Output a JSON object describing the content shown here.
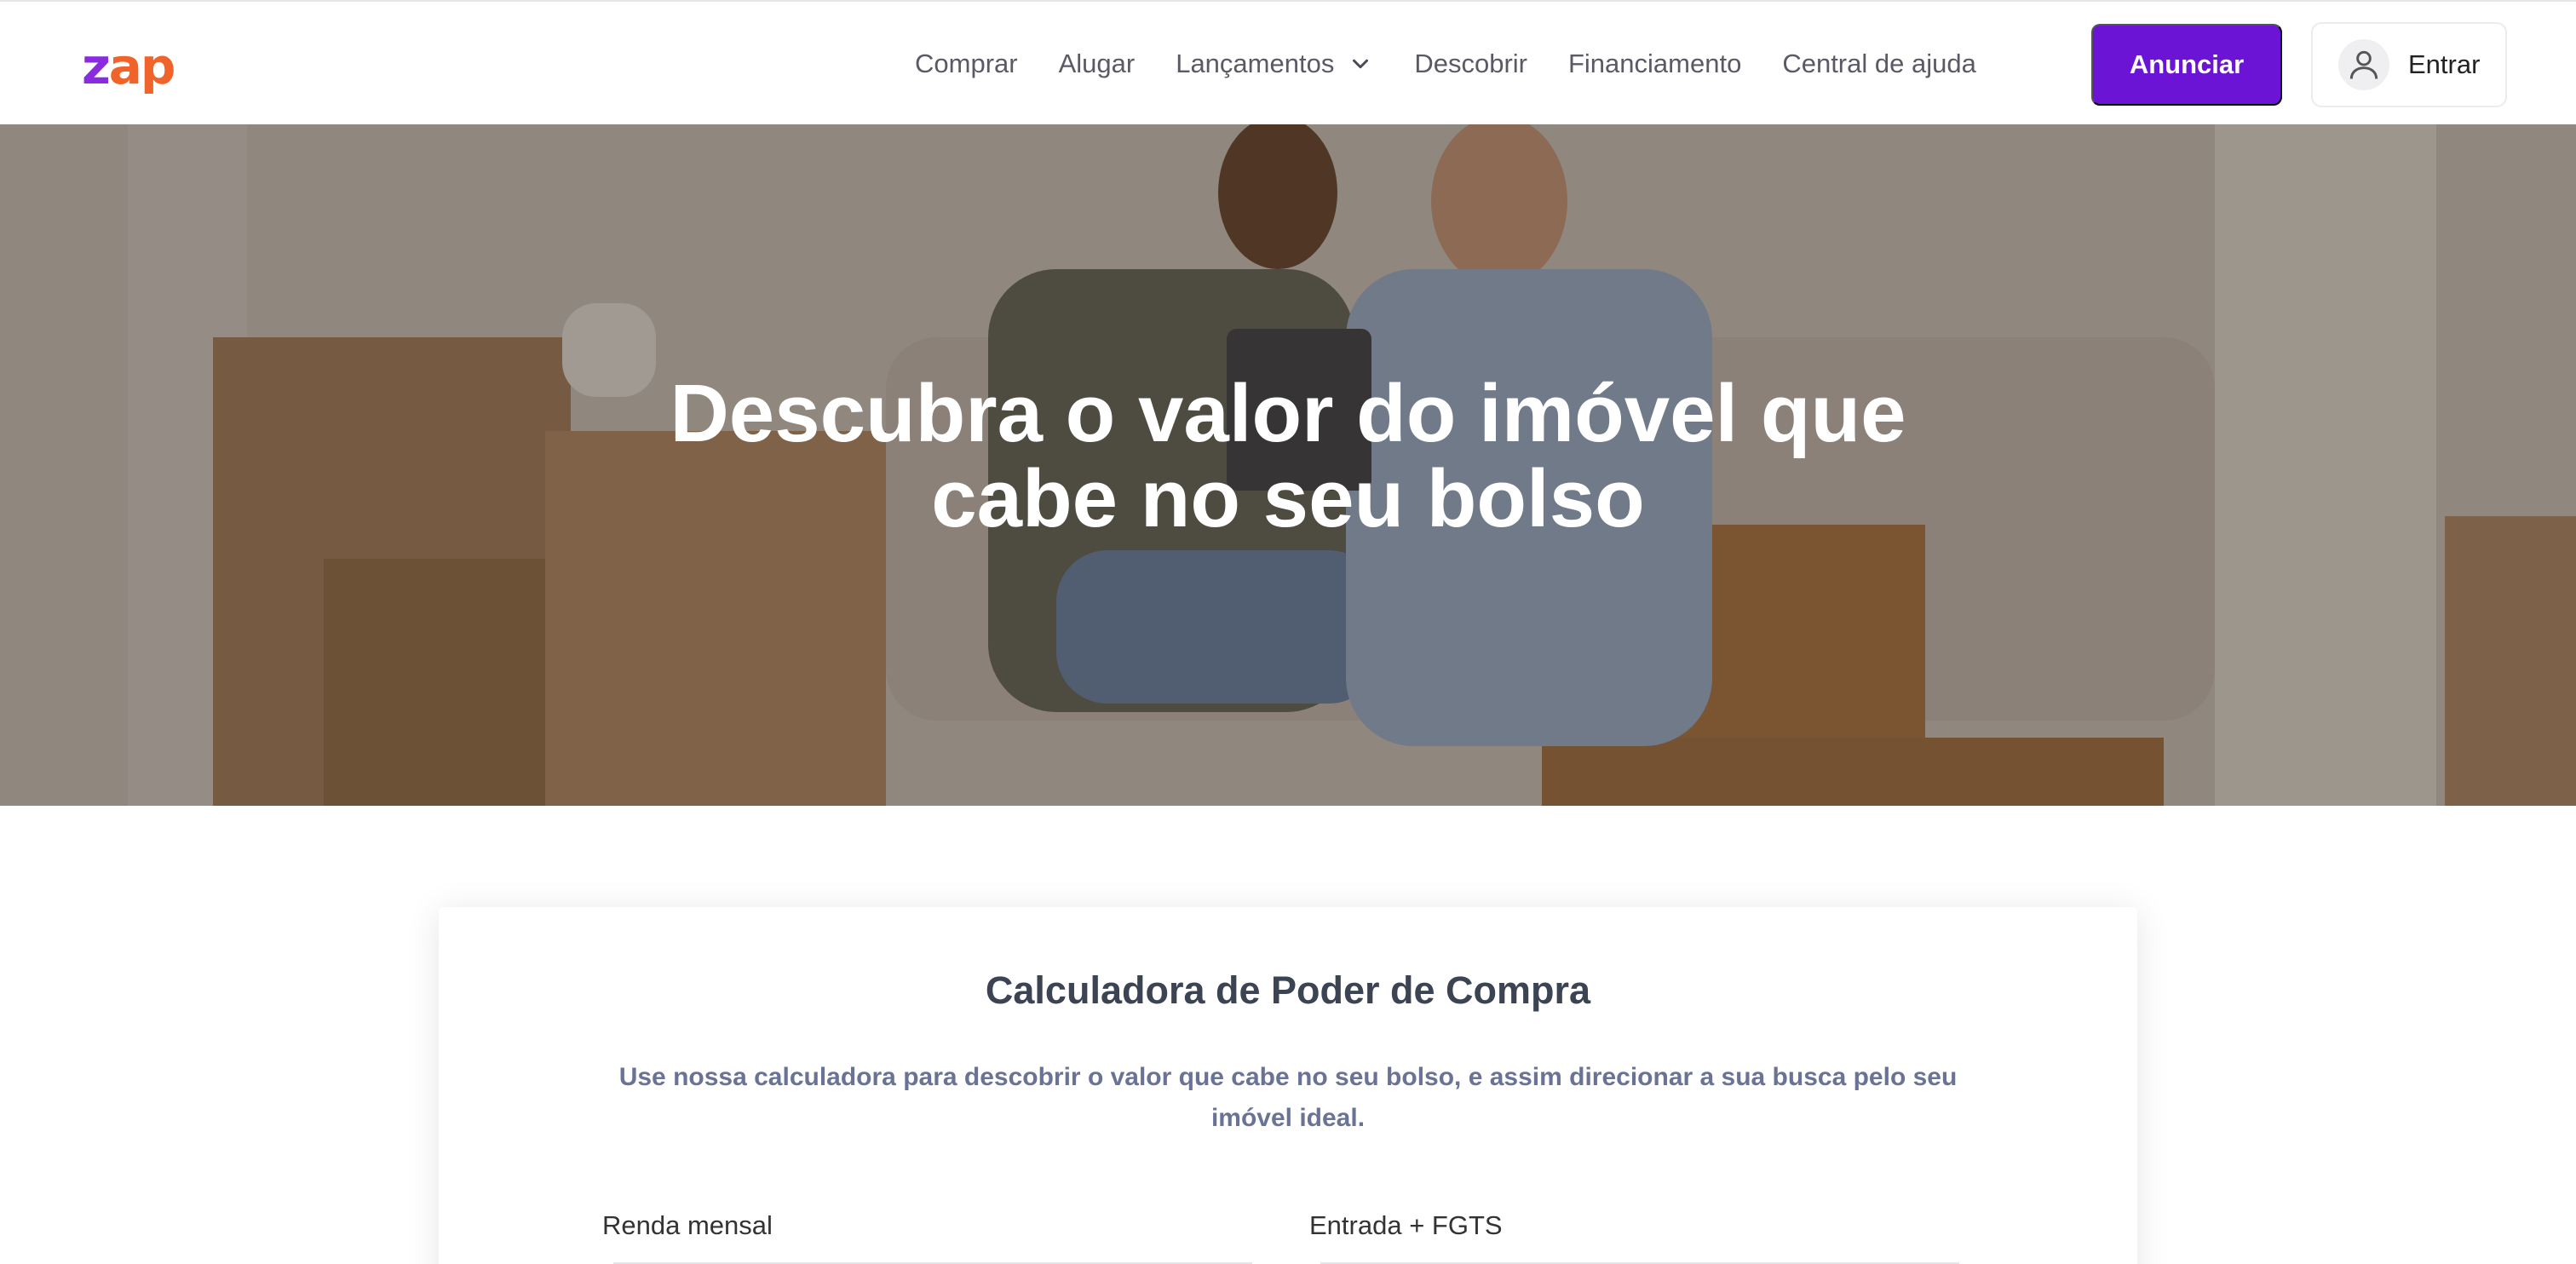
{
  "logo": {
    "z": "z",
    "rest": "ap"
  },
  "nav": {
    "comprar": "Comprar",
    "alugar": "Alugar",
    "lancamentos": "Lançamentos",
    "descobrir": "Descobrir",
    "financiamento": "Financiamento",
    "central": "Central de ajuda"
  },
  "actions": {
    "anunciar": "Anunciar",
    "entrar": "Entrar"
  },
  "hero": {
    "title_line1": "Descubra o valor do imóvel que",
    "title_line2": "cabe no seu bolso"
  },
  "calculator": {
    "title": "Calculadora de Poder de Compra",
    "description": "Use nossa calculadora para descobrir o valor que cabe no seu bolso, e assim direcionar a sua busca pelo seu imóvel ideal.",
    "renda_label": "Renda mensal",
    "entrada_label": "Entrada + FGTS"
  },
  "colors": {
    "brand_purple": "#6b14d6",
    "logo_orange": "#f0632a",
    "logo_purple": "#8a2be2",
    "nav_text": "#5a5a66"
  },
  "icons": {
    "lancamentos_chevron": "chevron-down-icon",
    "user": "user-icon"
  }
}
